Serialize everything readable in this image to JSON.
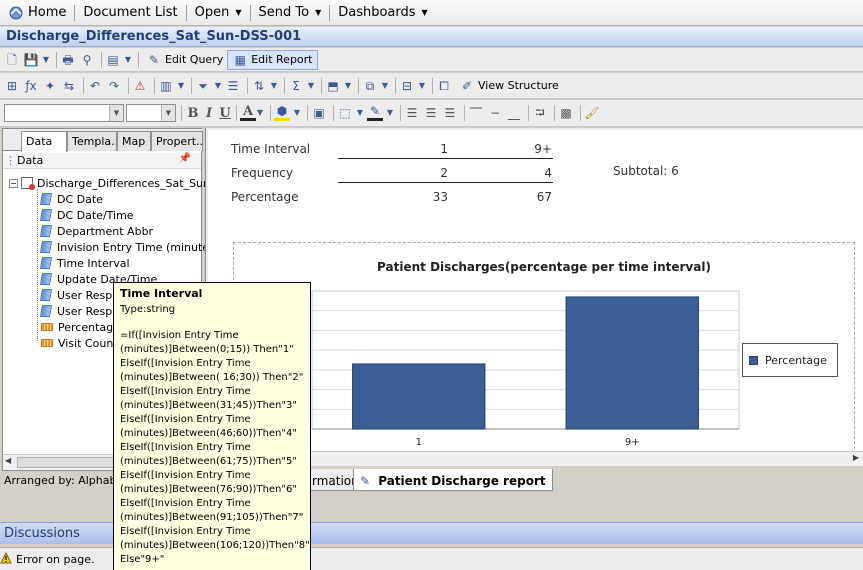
{
  "menu": {
    "home": "Home",
    "document_list": "Document List",
    "open": "Open",
    "send_to": "Send To",
    "dashboards": "Dashboards"
  },
  "document": {
    "title": "Discharge_Differences_Sat_Sun-DSS-001"
  },
  "toolbar": {
    "edit_query": "Edit Query",
    "edit_report": "Edit Report",
    "view_structure": "View Structure"
  },
  "left_panel": {
    "tabs": [
      "Data",
      "Templa..",
      "Map",
      "Propert.."
    ],
    "header": "Data",
    "root": "Discharge_Differences_Sat_Sun",
    "items": [
      {
        "label": "DC Date",
        "kind": "dimension"
      },
      {
        "label": "DC Date/Time",
        "kind": "dimension"
      },
      {
        "label": "Department Abbr",
        "kind": "dimension"
      },
      {
        "label": "Invision Entry Time (minutes",
        "kind": "dimension"
      },
      {
        "label": "Time Interval",
        "kind": "dimension"
      },
      {
        "label": "Update Date/Time",
        "kind": "dimension"
      },
      {
        "label": "User Resp",
        "kind": "dimension"
      },
      {
        "label": "User Resp",
        "kind": "dimension"
      },
      {
        "label": "Percentage",
        "kind": "measure"
      },
      {
        "label": "Visit Count",
        "kind": "measure"
      }
    ],
    "arranged_by": "Arranged by: Alphabe"
  },
  "report": {
    "table": {
      "rows": [
        {
          "label": "Time Interval",
          "values": [
            "1",
            "9+"
          ]
        },
        {
          "label": "Frequency",
          "values": [
            "2",
            "4"
          ]
        },
        {
          "label": "Percentage",
          "values": [
            "33",
            "67"
          ]
        }
      ],
      "subtotal": "Subtotal: 6"
    },
    "tabs": [
      "rmation",
      "Patient Discharge report"
    ]
  },
  "chart_data": {
    "type": "bar",
    "title": "Patient Discharges(percentage per time interval)",
    "categories": [
      "1",
      "9+"
    ],
    "series": [
      {
        "name": "Percentage",
        "values": [
          33,
          67
        ]
      }
    ],
    "ylim": [
      0,
      70
    ],
    "grid": true,
    "legend": "right",
    "bar_color": "#3c5f96"
  },
  "tooltip": {
    "title": "Time Interval",
    "type": "Type:string",
    "formula": "=If([Invision Entry Time\n(minutes)]Between(0;15)) Then\"1\"\nElseIf([Invision Entry Time\n(minutes)]Between( 16;30)) Then\"2\"\nElseIf([Invision Entry Time\n(minutes)]Between(31;45))Then\"3\"\nElseIf([Invision Entry Time\n(minutes)]Between(46;60))Then\"4\"\nElseIf([Invision Entry Time\n(minutes)]Between(61;75))Then\"5\"\nElseIf([Invision Entry Time\n(minutes)]Between(76;90))Then\"6\"\nElseIf([Invision Entry Time\n(minutes)]Between(91;105))Then\"7\"\nElseIf([Invision Entry Time\n(minutes)]Between(106;120))Then\"8\"\nElse\"9+\""
  },
  "bottom": {
    "discussions": "Discussions",
    "status": "Error on page."
  }
}
